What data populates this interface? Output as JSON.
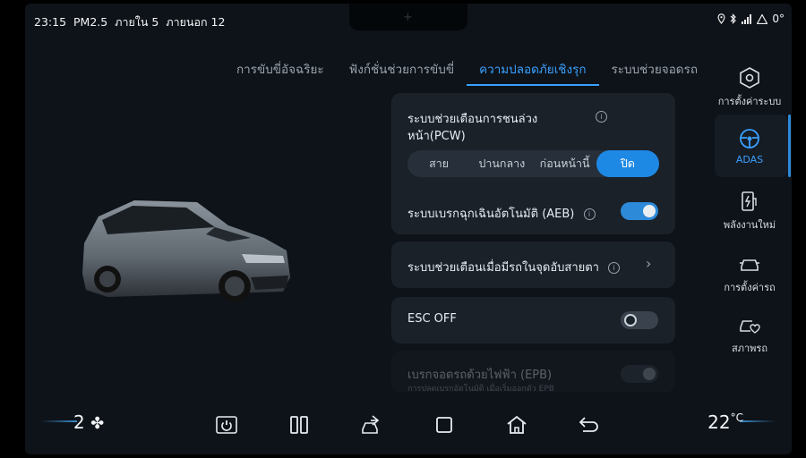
{
  "status": {
    "time": "23:15",
    "pm": "PM2.5",
    "inside": "ภายใน 5",
    "outside": "ภายนอก 12",
    "temp_outside": "0°"
  },
  "tabs": [
    {
      "label": "การขับขี่อัจฉริยะ",
      "active": false
    },
    {
      "label": "ฟังก์ชั่นช่วยการขับขี่",
      "active": false
    },
    {
      "label": "ความปลอดภัยเชิงรุก",
      "active": true
    },
    {
      "label": "ระบบช่วยจอดรถ",
      "active": false
    }
  ],
  "pcw": {
    "title_line1": "ระบบช่วยเตือนการชนล่วง",
    "title_line2": "หน้า(PCW)",
    "options": [
      "สาย",
      "ปานกลาง",
      "ก่อนหน้านี้",
      "ปิด"
    ],
    "selected": "ปิด"
  },
  "aeb": {
    "label": "ระบบเบรกฉุกเฉินอัตโนมัติ (AEB)",
    "enabled": true
  },
  "bsd": {
    "label": "ระบบช่วยเตือนเมื่อมีรถในจุดอับสายตา"
  },
  "esc": {
    "label": "ESC OFF",
    "enabled": false
  },
  "epb": {
    "label": "เบรกจอดรถด้วยไฟฟ้า (EPB)",
    "sublabel": "การปลดเบรกอัตโนมัติ เมื่อเริ่มออกตัว EPB",
    "enabled": false
  },
  "rnav": [
    {
      "label": "การตั้งค่าระบบ",
      "icon": "hexagon-settings-icon",
      "active": false
    },
    {
      "label": "ADAS",
      "icon": "steering-wheel-icon",
      "active": true
    },
    {
      "label": "พลังงานใหม่",
      "icon": "ev-charge-icon",
      "active": false
    },
    {
      "label": "การตั้งค่ารถ",
      "icon": "car-settings-icon",
      "active": false
    },
    {
      "label": "สภาพรถ",
      "icon": "car-health-icon",
      "active": false
    }
  ],
  "dock": {
    "fan_level": "2",
    "temperature": "22",
    "temp_unit": "°C"
  },
  "colors": {
    "accent": "#1e88e5",
    "background": "#0e1319",
    "card": "#1a2129"
  }
}
